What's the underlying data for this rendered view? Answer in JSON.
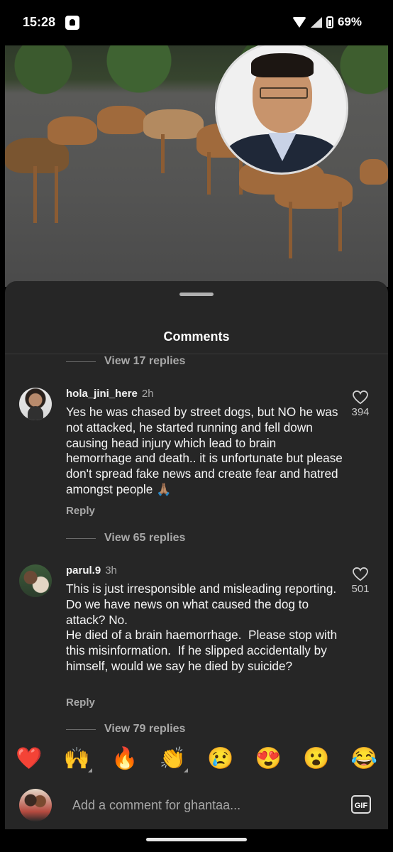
{
  "status_bar": {
    "time": "15:28",
    "battery": "69%",
    "icons": [
      "notification-icon",
      "wifi-icon",
      "cellular-signal-icon",
      "battery-icon"
    ]
  },
  "media": {
    "description_icons": [
      "street-dogs-photo",
      "person-portrait"
    ]
  },
  "sheet": {
    "title": "Comments",
    "top_view_replies": "View 17 replies",
    "comments": [
      {
        "user": "hola_jini_here",
        "time": "2h",
        "text": "Yes he was chased by street dogs, but NO he was not attacked, he started running and fell down causing head injury which lead to brain hemorrhage and death.. it is unfortunate but please don't spread fake news and create fear and hatred amongst people 🙏🏽",
        "likes": "394",
        "reply_label": "Reply",
        "view_replies": "View 65 replies"
      },
      {
        "user": "parul.9",
        "time": "3h",
        "text": "This is just irresponsible and misleading reporting.  Do we have news on what caused the dog to attack? No.\nHe died of a brain haemorrhage.  Please stop with this misinformation.  If he slipped accidentally by himself, would we say he died by suicide?",
        "likes": "501",
        "reply_label": "Reply",
        "view_replies": "View 79 replies"
      }
    ]
  },
  "reactions": [
    "❤️",
    "🙌",
    "🔥",
    "👏",
    "😢",
    "😍",
    "😮",
    "😂"
  ],
  "composer": {
    "placeholder": "Add a comment for ghantaa...",
    "gif_label": "GIF"
  }
}
